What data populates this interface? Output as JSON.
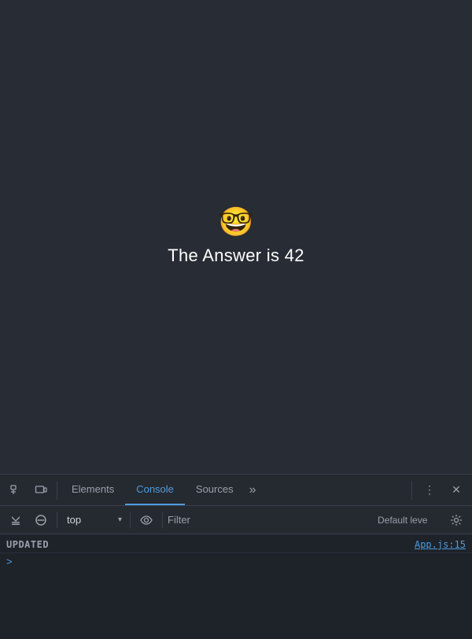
{
  "browser": {
    "main_content": {
      "emoji": "🤓",
      "heading": "The Answer is 42"
    }
  },
  "devtools": {
    "tabs": [
      {
        "id": "elements",
        "label": "Elements",
        "active": false
      },
      {
        "id": "console",
        "label": "Console",
        "active": true
      },
      {
        "id": "sources",
        "label": "Sources",
        "active": false
      }
    ],
    "more_tabs_label": "»",
    "context_options": [
      "top"
    ],
    "context_selected": "top",
    "filter_placeholder": "Filter",
    "level_label": "Default leve",
    "console_output": [
      {
        "message": "UPDATED",
        "source": "App.js:15"
      }
    ],
    "prompt_chevron": ">"
  },
  "icons": {
    "cursor_tool": "⬚",
    "device_toggle": "⧉",
    "clear_console": "🚫",
    "play": "▶",
    "eye": "👁",
    "gear": "⚙",
    "close": "✕",
    "more_options": "⋮",
    "chevron_down": "▾",
    "expand_arrow": "▶"
  }
}
